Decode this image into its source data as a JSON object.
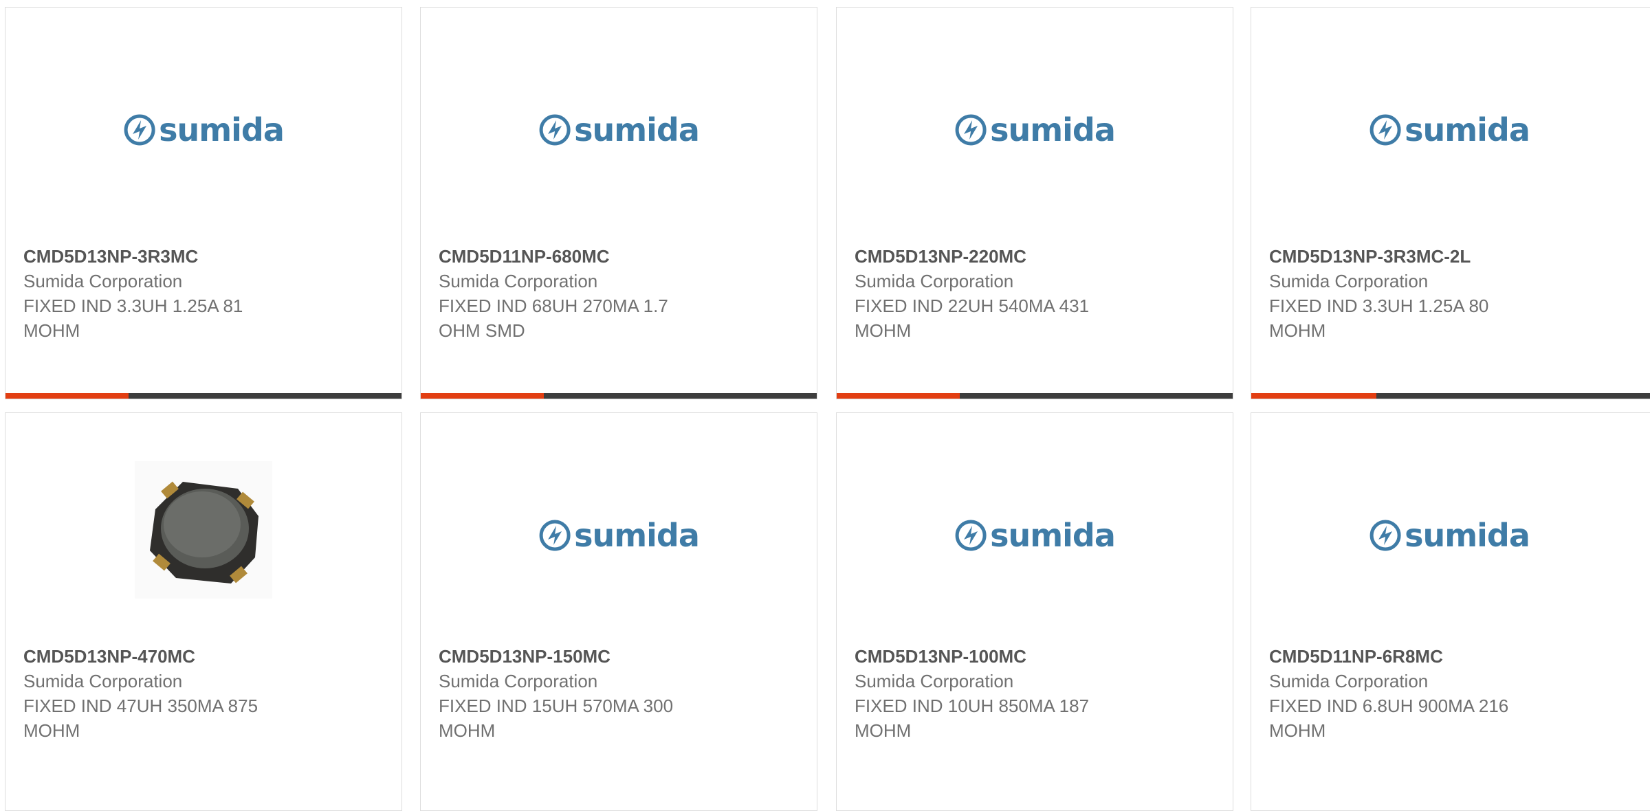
{
  "brand": {
    "logo_text": "sumida",
    "logo_color": "#3f7ca7"
  },
  "theme": {
    "accent": "#e23e12",
    "bar_base": "#3d3d3d",
    "text": "#707070"
  },
  "products": [
    {
      "part_number": "CMD5D13NP-3R3MC",
      "manufacturer": "Sumida Corporation",
      "description": "FIXED IND 3.3UH 1.25A 81 MOHM",
      "image": "sumida-logo",
      "progress": 0.31
    },
    {
      "part_number": "CMD5D11NP-680MC",
      "manufacturer": "Sumida Corporation",
      "description": "FIXED IND 68UH 270MA 1.7 OHM SMD",
      "image": "sumida-logo",
      "progress": 0.31
    },
    {
      "part_number": "CMD5D13NP-220MC",
      "manufacturer": "Sumida Corporation",
      "description": "FIXED IND 22UH 540MA 431 MOHM",
      "image": "sumida-logo",
      "progress": 0.31
    },
    {
      "part_number": "CMD5D13NP-3R3MC-2L",
      "manufacturer": "Sumida Corporation",
      "description": "FIXED IND 3.3UH 1.25A 80 MOHM",
      "image": "sumida-logo",
      "progress": 0.31
    },
    {
      "part_number": "CMD5D13NP-470MC",
      "manufacturer": "Sumida Corporation",
      "description": "FIXED IND 47UH 350MA 875 MOHM",
      "image": "inductor-photo"
    },
    {
      "part_number": "CMD5D13NP-150MC",
      "manufacturer": "Sumida Corporation",
      "description": "FIXED IND 15UH 570MA 300 MOHM",
      "image": "sumida-logo"
    },
    {
      "part_number": "CMD5D13NP-100MC",
      "manufacturer": "Sumida Corporation",
      "description": "FIXED IND 10UH 850MA 187 MOHM",
      "image": "sumida-logo"
    },
    {
      "part_number": "CMD5D11NP-6R8MC",
      "manufacturer": "Sumida Corporation",
      "description": "FIXED IND 6.8UH 900MA 216 MOHM",
      "image": "sumida-logo"
    }
  ]
}
